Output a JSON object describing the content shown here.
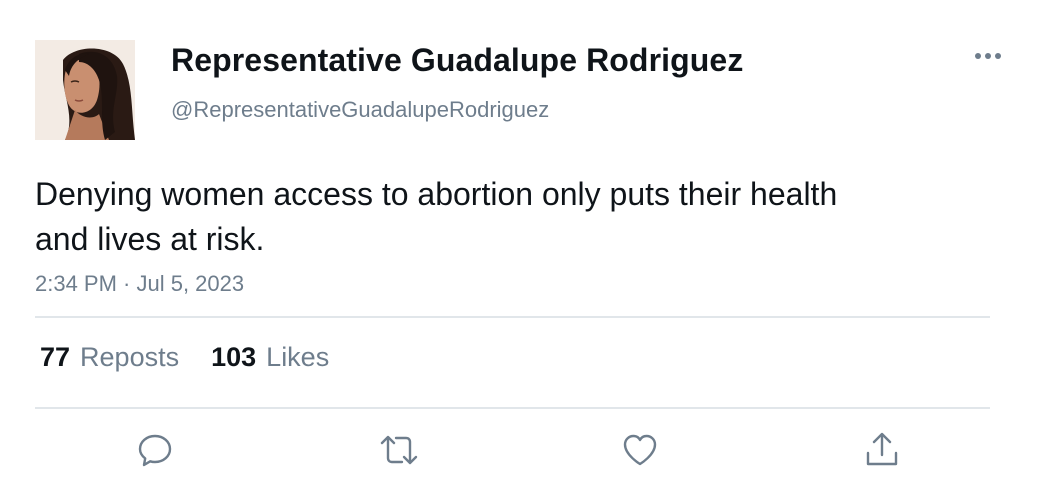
{
  "tweet": {
    "author": {
      "display_name": "Representative Guadalupe Rodriguez",
      "handle": "@RepresentativeGuadalupeRodriguez"
    },
    "text": "Denying women access to abortion only puts their health and lives at risk.",
    "timestamp": "2:34 PM · Jul 5, 2023",
    "stats": {
      "reposts_count": "77",
      "reposts_label": "Reposts",
      "likes_count": "103",
      "likes_label": "Likes"
    }
  },
  "icons": {
    "more": "more-horizontal-icon",
    "reply": "reply-bubble-icon",
    "repost": "repost-arrows-icon",
    "like": "heart-icon",
    "share": "share-upload-icon"
  },
  "colors": {
    "text_primary": "#0f1419",
    "text_secondary": "#6e7d8c",
    "divider": "#e1e6ea"
  }
}
